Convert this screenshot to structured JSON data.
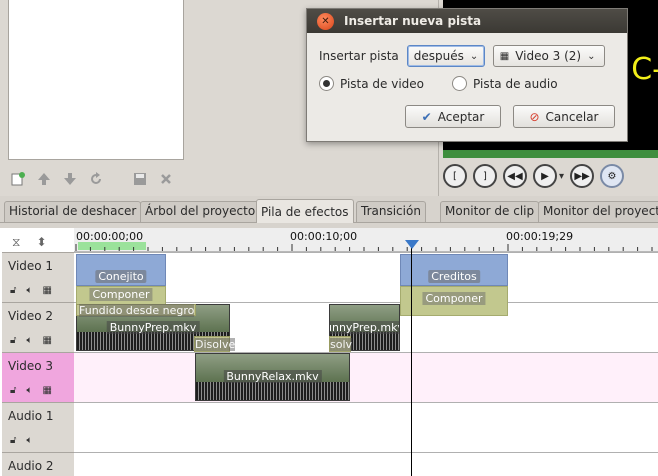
{
  "dialog": {
    "title": "Insertar nueva pista",
    "insert_label": "Insertar pista",
    "position_select": {
      "selected": "después"
    },
    "track_select": {
      "selected": "Video 3 (2)"
    },
    "radio_video": {
      "label": "Pista de video",
      "checked": true
    },
    "radio_audio": {
      "label": "Pista de audio",
      "checked": false
    },
    "ok_button": "Aceptar",
    "cancel_button": "Cancelar"
  },
  "monitor": {
    "overlay_text": "C-"
  },
  "tabs": [
    {
      "label": "Historial de deshacer",
      "active": false
    },
    {
      "label": "Árbol del proyecto",
      "active": false
    },
    {
      "label": "Pila de efectos",
      "active": true
    },
    {
      "label": "Transición",
      "active": false
    },
    {
      "label": "Monitor de clip",
      "active": false
    },
    {
      "label": "Monitor del proyecto",
      "active": false
    }
  ],
  "ruler": {
    "timecodes": [
      "00:00:00;00",
      "00:00:10;00",
      "00:00:19;29"
    ]
  },
  "tracks": [
    {
      "name": "Video 1",
      "selected": false
    },
    {
      "name": "Video 2",
      "selected": false
    },
    {
      "name": "Video 3",
      "selected": true
    },
    {
      "name": "Audio 1",
      "selected": false
    },
    {
      "name": "Audio 2",
      "selected": false
    }
  ],
  "clips": {
    "conejito": "Conejito",
    "creditos": "Creditos",
    "composite_1": "Componer",
    "composite_2": "Componer",
    "fade": "Fundido desde negro",
    "bunnyprep_1": "BunnyPrep.mkv",
    "bunnyprep_2": "unnyPrep.mkv",
    "bunnyrelax": "BunnyRelax.mkv",
    "dissolve_1": "Disolve",
    "dissolve_2": "solv"
  },
  "colors": {
    "accent": "#3a78c8",
    "selected_track": "#f0a6de",
    "title_clip": "#8ea9d6",
    "composite": "#c2c88e",
    "zone": "#9be29b"
  }
}
